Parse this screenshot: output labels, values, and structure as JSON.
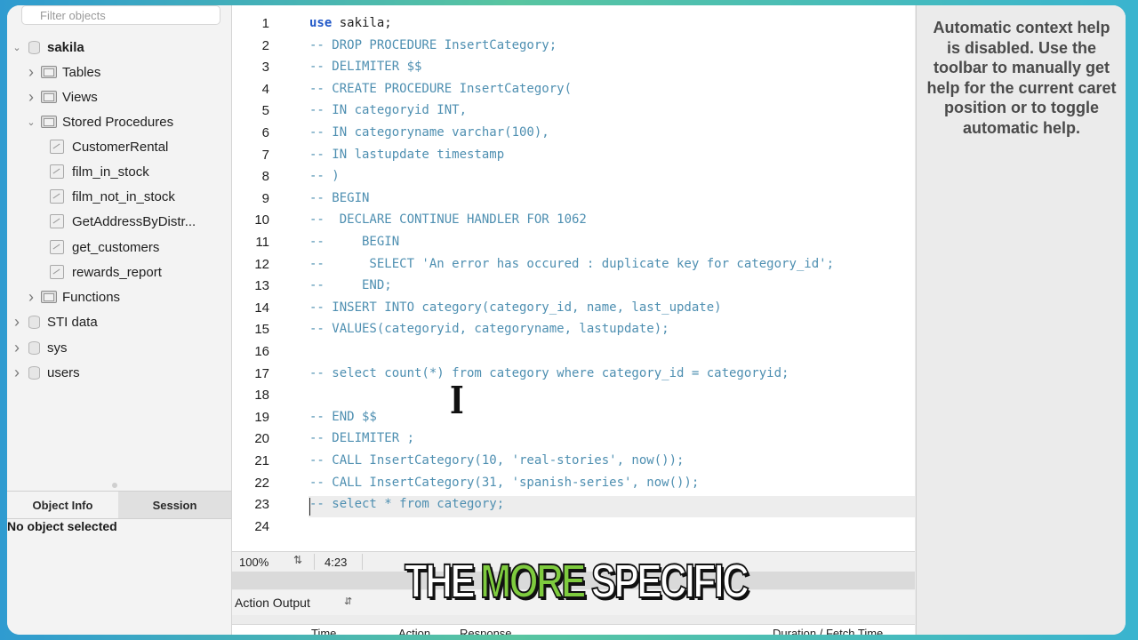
{
  "sidebar": {
    "filter_placeholder": "Filter objects",
    "tree": [
      {
        "label": "sakila",
        "expanded": true,
        "kind": "schema",
        "bold": true
      },
      {
        "label": "Tables",
        "kind": "folder"
      },
      {
        "label": "Views",
        "kind": "folder"
      },
      {
        "label": "Stored Procedures",
        "kind": "folder",
        "expanded": true
      },
      {
        "label": "CustomerRental",
        "kind": "procedure"
      },
      {
        "label": "film_in_stock",
        "kind": "procedure"
      },
      {
        "label": "film_not_in_stock",
        "kind": "procedure"
      },
      {
        "label": "GetAddressByDistr...",
        "kind": "procedure"
      },
      {
        "label": "get_customers",
        "kind": "procedure"
      },
      {
        "label": "rewards_report",
        "kind": "procedure"
      },
      {
        "label": "Functions",
        "kind": "folder"
      },
      {
        "label": "STI data",
        "kind": "schema"
      },
      {
        "label": "sys",
        "kind": "schema"
      },
      {
        "label": "users",
        "kind": "schema"
      }
    ],
    "tabs": {
      "object_info": "Object Info",
      "session": "Session"
    },
    "no_object": "No object selected"
  },
  "editor": {
    "line_numbers": [
      "1",
      "2",
      "3",
      "4",
      "5",
      "6",
      "7",
      "8",
      "9",
      "10",
      "11",
      "12",
      "13",
      "14",
      "15",
      "16",
      "17",
      "18",
      "19",
      "20",
      "21",
      "22",
      "23",
      "24"
    ],
    "lines": [
      {
        "kw": "use",
        "rest": " sakila;"
      },
      {
        "text": "-- DROP PROCEDURE InsertCategory;"
      },
      {
        "text": "-- DELIMITER $$"
      },
      {
        "text": "-- CREATE PROCEDURE InsertCategory("
      },
      {
        "text": "-- IN categoryid INT,"
      },
      {
        "text": "-- IN categoryname varchar(100),"
      },
      {
        "text": "-- IN lastupdate timestamp"
      },
      {
        "text": "-- )"
      },
      {
        "text": "-- BEGIN"
      },
      {
        "text": "--  DECLARE CONTINUE HANDLER FOR 1062"
      },
      {
        "text": "--     BEGIN"
      },
      {
        "text": "--      SELECT 'An error has occured : duplicate key for category_id';"
      },
      {
        "text": "--     END;"
      },
      {
        "text": "-- INSERT INTO category(category_id, name, last_update)"
      },
      {
        "text": "-- VALUES(categoryid, categoryname, lastupdate);"
      },
      {
        "text": ""
      },
      {
        "text": "-- select count(*) from category where category_id = categoryid;"
      },
      {
        "text": ""
      },
      {
        "text": "-- END $$"
      },
      {
        "text": "-- DELIMITER ;"
      },
      {
        "text": "-- CALL InsertCategory(10, 'real-stories', now());"
      },
      {
        "text": "-- CALL InsertCategory(31, 'spanish-series', now());"
      },
      {
        "text": "-- select * from category;"
      },
      {
        "text": ""
      }
    ]
  },
  "status": {
    "zoom": "100%",
    "position": "4:23"
  },
  "output": {
    "selector_label": "Action Output",
    "columns": [
      "Time",
      "Action",
      "Response",
      "Duration / Fetch Time"
    ]
  },
  "help": {
    "text": "Automatic context help is disabled. Use the toolbar to manually get help for the current caret position or to toggle automatic help."
  },
  "caption": {
    "w1": "THE",
    "w2": "MORE",
    "w3": "SPECIFIC"
  },
  "colors": {
    "comment": "#4e8fb1",
    "keyword": "#2158c8",
    "caption_highlight": "#7ecb3e"
  }
}
